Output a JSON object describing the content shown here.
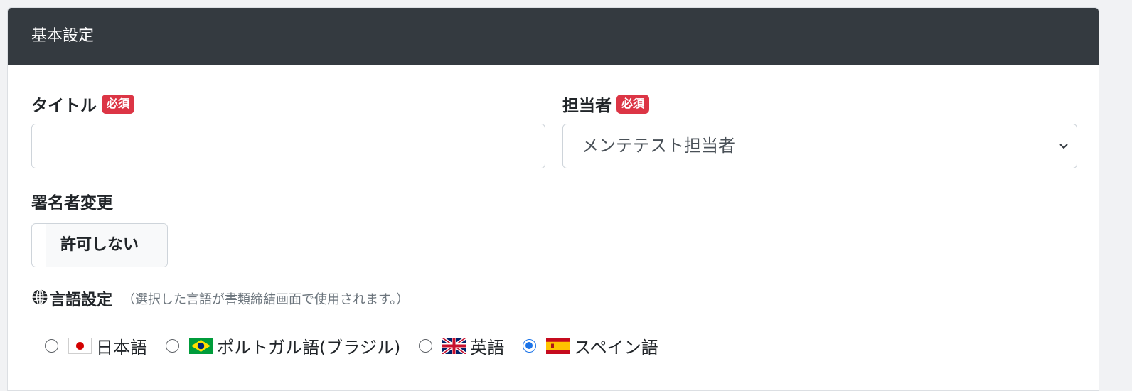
{
  "header": {
    "title": "基本設定"
  },
  "title_field": {
    "label": "タイトル",
    "badge": "必須",
    "value": "",
    "placeholder": ""
  },
  "assignee_field": {
    "label": "担当者",
    "badge": "必須",
    "selected": "メンテテスト担当者"
  },
  "signer_change": {
    "label": "署名者変更",
    "button_label": "許可しない"
  },
  "language": {
    "title": "言語設定",
    "note": "（選択した言語が書類締結画面で使用されます。）",
    "options": [
      {
        "label": "日本語",
        "flag": "flag-japan",
        "checked": false
      },
      {
        "label": "ポルトガル語(ブラジル)",
        "flag": "flag-brazil",
        "checked": false
      },
      {
        "label": "英語",
        "flag": "flag-uk",
        "checked": false
      },
      {
        "label": "スペイン語",
        "flag": "flag-spain",
        "checked": true
      }
    ]
  },
  "colors": {
    "header_bg": "#343a40",
    "badge_bg": "#dc3545",
    "radio_accent": "#1a73e8"
  }
}
